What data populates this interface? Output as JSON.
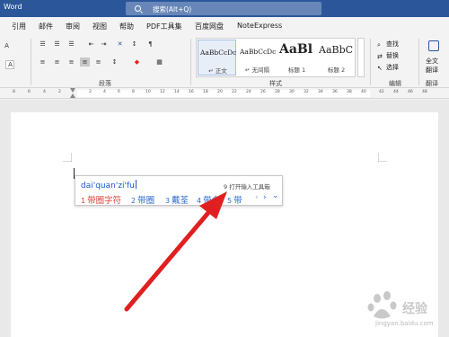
{
  "titlebar": {
    "app_name": "Word",
    "search_label": "搜索(Alt+Q)"
  },
  "tabs": [
    "引用",
    "邮件",
    "审阅",
    "视图",
    "帮助",
    "PDF工具集",
    "百度网盘",
    "NoteExpress"
  ],
  "ribbon": {
    "group_paragraph": "段落",
    "group_styles": "样式",
    "group_editing": "编辑",
    "group_translate": "翻译",
    "styles": [
      {
        "preview": "AaBbCcDc",
        "name": "↵ 正文"
      },
      {
        "preview": "AaBbCcDc",
        "name": "↵ 无间隔"
      },
      {
        "preview": "AaBl",
        "name": "标题 1"
      },
      {
        "preview": "AaBbC",
        "name": "标题 2"
      }
    ],
    "editing": {
      "find": "查找",
      "replace": "替换",
      "select": "选择"
    },
    "translate": {
      "line1": "全文",
      "line2": "翻译"
    }
  },
  "ruler": {
    "ticks": [
      "8",
      "6",
      "4",
      "2",
      "2",
      "4",
      "6",
      "8",
      "10",
      "12",
      "14",
      "16",
      "18",
      "20",
      "22",
      "24",
      "26",
      "28",
      "30",
      "32",
      "34",
      "36",
      "38",
      "40",
      "42",
      "44",
      "46",
      "48"
    ]
  },
  "ime": {
    "input": "dai'quan'zi'fu",
    "toolbox_hint": "9 打开输入工具箱",
    "candidates": [
      {
        "num": "1",
        "text": "带圈字符"
      },
      {
        "num": "2",
        "text": "带圈"
      },
      {
        "num": "3",
        "text": "戴荃"
      },
      {
        "num": "4",
        "text": "带全"
      },
      {
        "num": "5",
        "text": "带"
      }
    ],
    "nav_prev": "‹",
    "nav_next": "›",
    "nav_more": "⌄"
  },
  "watermark": {
    "text": "jingyan.baidu.com"
  },
  "colors": {
    "titlebar": "#2b579a",
    "arrow": "#e02020",
    "candidate_first": "#e0443a",
    "candidate": "#2f6bd0"
  }
}
